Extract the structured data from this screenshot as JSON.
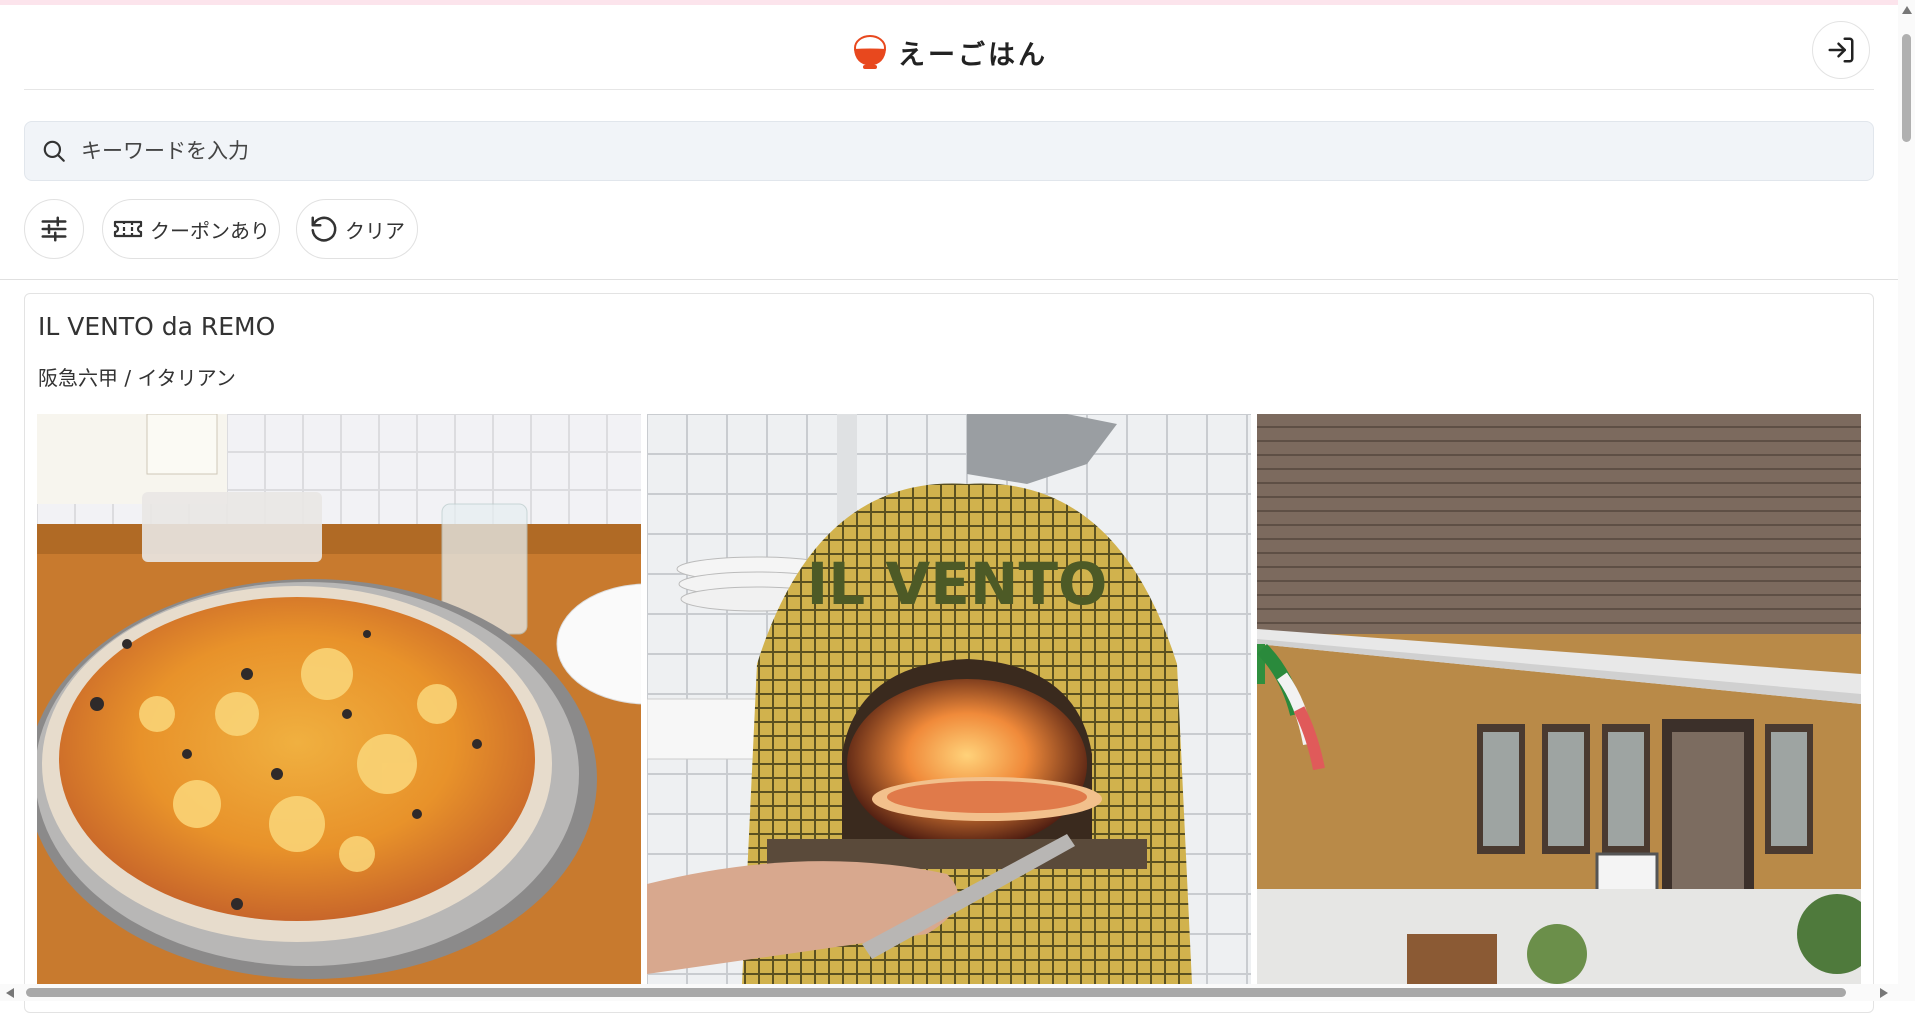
{
  "header": {
    "logo_text": "えーごはん",
    "brand_color": "#e8481e"
  },
  "search": {
    "placeholder": "キーワードを入力"
  },
  "filters": {
    "settings_icon": "sliders-icon",
    "coupon_label": "クーポンあり",
    "coupon_icon": "ticket-icon",
    "clear_label": "クリア",
    "clear_icon": "rotate-ccw-icon"
  },
  "restaurant": {
    "name": "IL VENTO da REMO",
    "meta": "阪急六甲 / イタリアン",
    "oven_text": "IL VENTO"
  },
  "icons": {
    "login": "login-icon",
    "search": "search-icon"
  }
}
